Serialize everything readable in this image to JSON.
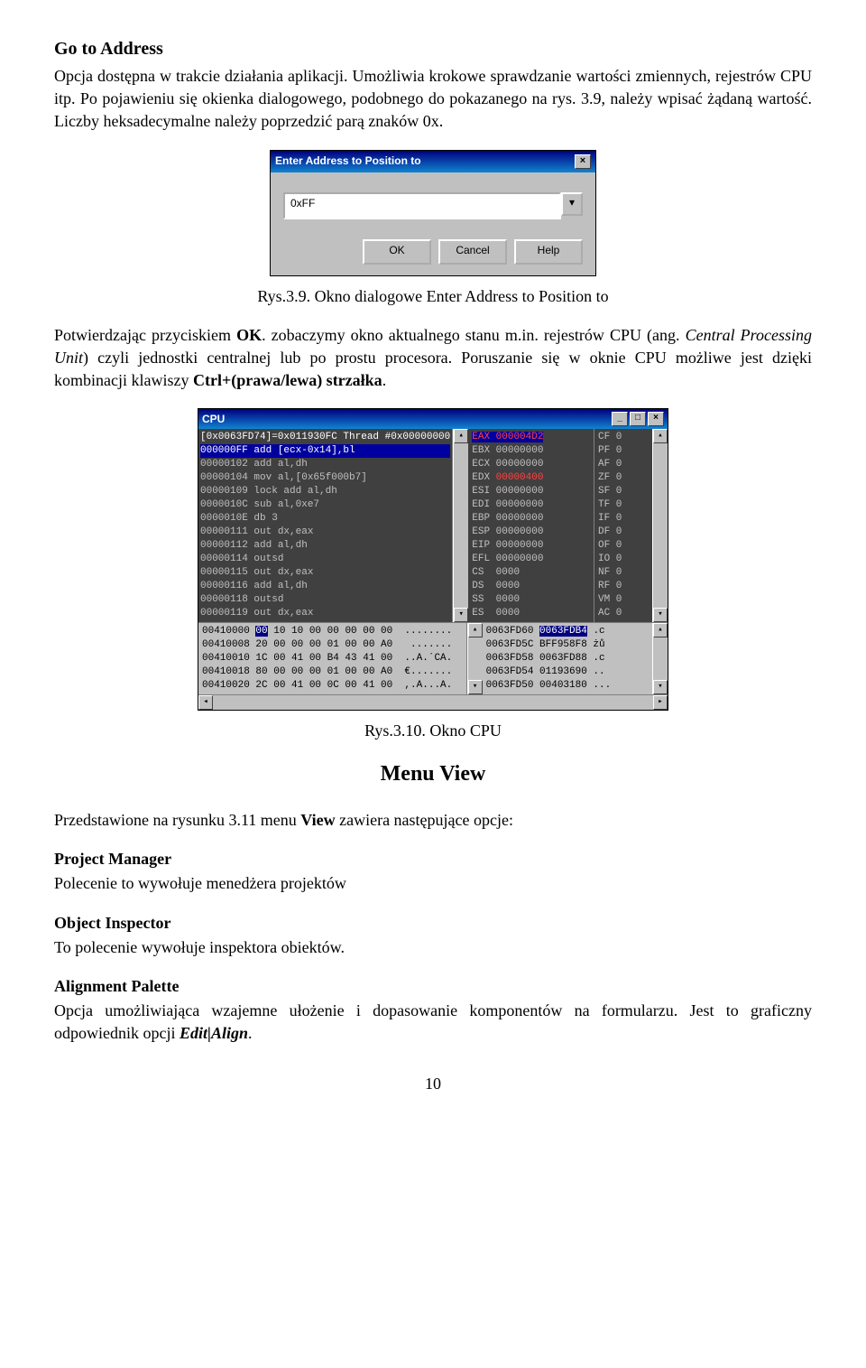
{
  "heading1_title": "Go to Address",
  "para1": "Opcja dostępna w trakcie działania aplikacji. Umożliwia krokowe sprawdzanie wartości zmiennych, rejestrów CPU itp. Po pojawieniu się okienka dialogowego, podobnego do pokazanego na rys. 3.9, należy wpisać żądaną wartość. Liczby heksadecymalne należy poprzedzić parą znaków 0x.",
  "dlg1": {
    "title": "Enter Address to Position to",
    "close": "×",
    "input_value": "0xFF",
    "dropdown_glyph": "▾",
    "ok": "OK",
    "cancel": "Cancel",
    "help": "Help"
  },
  "caption1": "Rys.3.9. Okno dialogowe Enter Address to Position to",
  "para2_a": "Potwierdzając przyciskiem ",
  "para2_ok": "OK",
  "para2_b": ". zobaczymy okno aktualnego stanu m.in. rejestrów CPU (ang. ",
  "para2_i": "Central Processing Unit",
  "para2_c": ") czyli jednostki centralnej lub po prostu procesora. Poruszanie się w oknie CPU możliwe jest dzięki kombinacji klawiszy ",
  "para2_key": "Ctrl+(prawa/lewa) strzałka",
  "para2_d": ".",
  "dlg2": {
    "title": "CPU",
    "sys_min": "_",
    "sys_max": "□",
    "sys_close": "×",
    "header_line": "[0x0063FD74]=0x011930FC Thread #0x00000000",
    "disasm": [
      {
        "t": "000000FF add [ecx-0x14],bl",
        "hl": true
      },
      {
        "t": "00000102 add al,dh"
      },
      {
        "t": "00000104 mov al,[0x65f000b7]"
      },
      {
        "t": "00000109 lock add al,dh"
      },
      {
        "t": "0000010C sub al,0xe7"
      },
      {
        "t": "0000010E db 3"
      },
      {
        "t": "00000111 out dx,eax"
      },
      {
        "t": "00000112 add al,dh"
      },
      {
        "t": "00000114 outsd"
      },
      {
        "t": "00000115 out dx,eax"
      },
      {
        "t": "00000116 add al,dh"
      },
      {
        "t": "00000118 outsd"
      },
      {
        "t": "00000119 out dx,eax"
      }
    ],
    "regs": [
      {
        "n": "EAX",
        "v": "000004D2",
        "red": true,
        "hl": true
      },
      {
        "n": "EBX",
        "v": "00000000"
      },
      {
        "n": "ECX",
        "v": "00000000"
      },
      {
        "n": "EDX",
        "v": "00000400",
        "red": true
      },
      {
        "n": "ESI",
        "v": "00000000"
      },
      {
        "n": "EDI",
        "v": "00000000"
      },
      {
        "n": "EBP",
        "v": "00000000"
      },
      {
        "n": "ESP",
        "v": "00000000"
      },
      {
        "n": "EIP",
        "v": "00000000"
      },
      {
        "n": "EFL",
        "v": "00000000"
      },
      {
        "n": "CS",
        "v": "0000"
      },
      {
        "n": "DS",
        "v": "0000"
      },
      {
        "n": "SS",
        "v": "0000"
      },
      {
        "n": "ES",
        "v": "0000"
      }
    ],
    "flags": [
      {
        "n": "CF",
        "v": "0"
      },
      {
        "n": "PF",
        "v": "0"
      },
      {
        "n": "AF",
        "v": "0"
      },
      {
        "n": "ZF",
        "v": "0"
      },
      {
        "n": "SF",
        "v": "0"
      },
      {
        "n": "TF",
        "v": "0"
      },
      {
        "n": "IF",
        "v": "0"
      },
      {
        "n": "DF",
        "v": "0"
      },
      {
        "n": "OF",
        "v": "0"
      },
      {
        "n": "IO",
        "v": "0"
      },
      {
        "n": "NF",
        "v": "0"
      },
      {
        "n": "RF",
        "v": "0"
      },
      {
        "n": "VM",
        "v": "0"
      },
      {
        "n": "AC",
        "v": "0"
      }
    ],
    "hex": [
      {
        "a": "00410000",
        "b": "00 10 10 00 00 00 00 00",
        "t": "........",
        "sel": true
      },
      {
        "a": "00410008",
        "b": "20 00 00 00 01 00 00 A0",
        "t": " .......",
        "sel": false
      },
      {
        "a": "00410010",
        "b": "1C 00 41 00 B4 43 41 00",
        "t": "..A.´CA.",
        "sel": false
      },
      {
        "a": "00410018",
        "b": "80 00 00 00 01 00 00 A0",
        "t": "€.......",
        "sel": false
      },
      {
        "a": "00410020",
        "b": "2C 00 41 00 0C 00 41 00",
        "t": ",.A...A.",
        "sel": false
      }
    ],
    "stack": [
      {
        "a": "0063FD60",
        "v": "0063FDB4",
        "hl": true,
        "t": ".c"
      },
      {
        "a": "0063FD5C",
        "v": "BFF958F8",
        "t": "żů"
      },
      {
        "a": "0063FD58",
        "v": "0063FD88",
        "t": ".c"
      },
      {
        "a": "0063FD54",
        "v": "01193690",
        "t": ".."
      },
      {
        "a": "0063FD50",
        "v": "00403180",
        "t": "..."
      }
    ],
    "arrow_up": "▴",
    "arrow_down": "▾",
    "arrow_left": "◂",
    "arrow_right": "▸"
  },
  "caption2": "Rys.3.10. Okno CPU",
  "menu_heading": "Menu View",
  "para3_a": "Przedstawione na rysunku 3.11 menu ",
  "para3_view": "View",
  "para3_b": " zawiera następujące opcje:",
  "sec1_head": "Project Manager",
  "sec1_body": "Polecenie to wywołuje menedżera projektów",
  "sec2_head": "Object Inspector",
  "sec2_body": "To polecenie wywołuje inspektora obiektów.",
  "sec3_head": "Alignment Palette",
  "sec3_body_a": "Opcja umożliwiająca wzajemne ułożenie i dopasowanie komponentów na formularzu. Jest to graficzny odpowiednik opcji ",
  "sec3_body_i": "Edit|Align",
  "sec3_body_b": ".",
  "page_num": "10"
}
